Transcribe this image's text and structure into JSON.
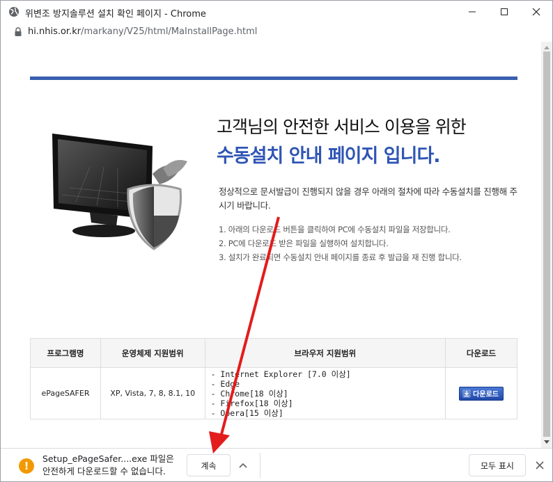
{
  "window": {
    "title": "위변조 방지솔루션 설치 확인 페이지 - Chrome",
    "icon": "globe-icon"
  },
  "address": {
    "host": "hi.nhis.or.kr",
    "path": "/markany/V25/html/MaInstallPage.html"
  },
  "page": {
    "heading_line1": "고객님의 안전한 서비스 이용을 위한",
    "heading_line2": "수동설치 안내 페이지 입니다.",
    "intro": "정상적으로 문서발급이 진행되지 않을 경우 아래의 절차에 따라 수동설치를 진행해 주시기 바랍니다.",
    "steps": [
      "1. 아래의 다운로드 버튼을 클릭하여 PC에 수동설치 파일을 저장합니다.",
      "2. PC에 다운로드 받은 파일을 실행하여 설치합니다.",
      "3. 설치가 완료되면 수동설치 안내 페이지를 종료 후 발급을 재 진행 합니다."
    ],
    "accent_color": "#2f55b4"
  },
  "table": {
    "headers": [
      "프로그램명",
      "운영체제 지원범위",
      "브라우저 지원범위",
      "다운로드"
    ],
    "rows": [
      {
        "program": "ePageSAFER",
        "os": "XP, Vista, 7, 8, 8.1, 10",
        "browsers": [
          "- Internet Explorer [7.0 이상]",
          "- Edge",
          "- Chrome[18 이상]",
          "- Firefox[18 이상]",
          "- Opera[15 이상]"
        ],
        "download_label": "다운로드"
      }
    ]
  },
  "download_bar": {
    "message_line1": "Setup_ePageSafer....exe 파일은",
    "message_line2": "안전하게 다운로드할 수 없습니다.",
    "keep_label": "계속",
    "show_all_label": "모두 표시",
    "warning_color": "#f29900"
  }
}
